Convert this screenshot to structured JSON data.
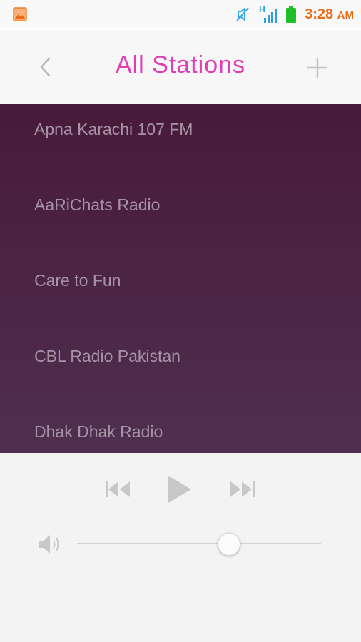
{
  "status_bar": {
    "time": "3:28",
    "ampm": "AM",
    "network_type": "H",
    "icons": [
      "gallery-icon",
      "muted-icon",
      "signal-icon",
      "battery-icon"
    ],
    "accent_color": "#ee6a14"
  },
  "header": {
    "title": "All Stations",
    "back_icon": "chevron-left-icon",
    "add_icon": "plus-icon",
    "title_color": "#e23cb4"
  },
  "stations": [
    {
      "name": "Apna Karachi 107 FM"
    },
    {
      "name": "AaRiChats Radio"
    },
    {
      "name": "Care to Fun"
    },
    {
      "name": "CBL Radio Pakistan"
    },
    {
      "name": "Dhak Dhak Radio"
    }
  ],
  "player": {
    "controls": [
      "previous-icon",
      "play-icon",
      "next-icon"
    ],
    "volume_icon": "speaker-icon",
    "volume_level": 0.62
  }
}
